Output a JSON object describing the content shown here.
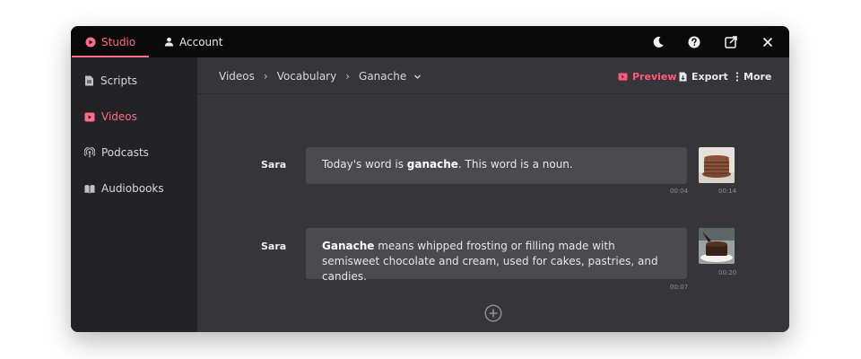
{
  "topbar": {
    "tabs": [
      {
        "label": "Studio",
        "icon": "studio-icon",
        "active": true
      },
      {
        "label": "Account",
        "icon": "user-icon",
        "active": false
      }
    ],
    "icons": [
      "moon-icon",
      "help-icon",
      "external-link-icon",
      "close-icon"
    ]
  },
  "sidebar": {
    "items": [
      {
        "label": "Scripts",
        "icon": "document-icon",
        "active": false
      },
      {
        "label": "Videos",
        "icon": "video-icon",
        "active": true
      },
      {
        "label": "Podcasts",
        "icon": "podcast-icon",
        "active": false
      },
      {
        "label": "Audiobooks",
        "icon": "audiobook-icon",
        "active": false
      }
    ]
  },
  "breadcrumb": {
    "items": [
      "Videos",
      "Vocabulary",
      "Ganache"
    ]
  },
  "actions": {
    "preview": "Preview",
    "export": "Export",
    "more": "More"
  },
  "script": {
    "lines": [
      {
        "speaker": "Sara",
        "text_before": "Today's word is ",
        "bold": "ganache",
        "text_after": ". This word is a noun.",
        "duration": "00:04",
        "thumb_time": "00:14"
      },
      {
        "speaker": "Sara",
        "text_before": "",
        "bold": "Ganache",
        "text_after": " means whipped frosting or filling made with semisweet chocolate and cream, used for cakes, pastries, and candies.",
        "duration": "00:07",
        "thumb_time": "00:20"
      }
    ]
  },
  "colors": {
    "accent": "#ff6b8a",
    "window_bg": "#36363a",
    "sidebar_bg": "#232326",
    "topbar_bg": "#0a0a0b"
  }
}
